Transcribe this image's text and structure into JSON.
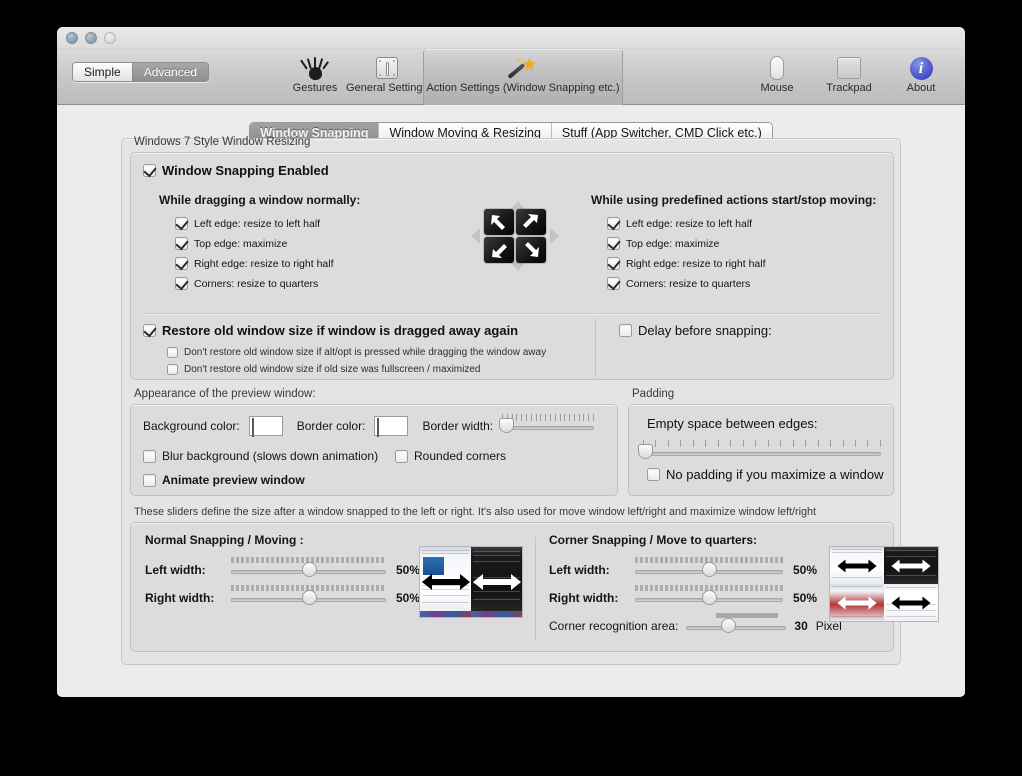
{
  "window": {
    "traffic_lights": [
      "close",
      "minimize",
      "zoom"
    ],
    "mode_segmented": {
      "options": [
        "Simple",
        "Advanced"
      ],
      "selected": "Advanced"
    },
    "toolbar_items": [
      {
        "label": "Gestures",
        "icon": "hand-icon",
        "selected": false
      },
      {
        "label": "General Settings",
        "icon": "mouse-general-icon",
        "selected": false
      },
      {
        "label": "Action Settings (Window Snapping etc.)",
        "icon": "magic-wand-icon",
        "selected": true
      }
    ],
    "toolbar_right_items": [
      {
        "label": "Mouse",
        "icon": "mouse-icon"
      },
      {
        "label": "Trackpad",
        "icon": "trackpad-icon"
      },
      {
        "label": "About",
        "icon": "info-icon"
      }
    ]
  },
  "tabs": [
    {
      "label": "Window Snapping",
      "active": true
    },
    {
      "label": "Window Moving & Resizing",
      "active": false
    },
    {
      "label": "Stuff (App Switcher, CMD Click etc.)",
      "active": false
    }
  ],
  "snapping": {
    "group_label": "Windows 7 Style Window Resizing",
    "enabled": {
      "label": "Window Snapping Enabled",
      "checked": true
    },
    "left_column": {
      "heading": "While dragging a window normally:",
      "items": [
        {
          "label": "Left edge: resize to left half",
          "checked": true
        },
        {
          "label": "Top edge: maximize",
          "checked": true
        },
        {
          "label": "Right edge: resize to right half",
          "checked": true
        },
        {
          "label": "Corners: resize to quarters",
          "checked": true
        }
      ]
    },
    "right_column": {
      "heading": "While using predefined actions start/stop moving:",
      "items": [
        {
          "label": "Left edge: resize to left half",
          "checked": true
        },
        {
          "label": "Top edge: maximize",
          "checked": true
        },
        {
          "label": "Right edge: resize to right half",
          "checked": true
        },
        {
          "label": "Corners: resize to quarters",
          "checked": true
        }
      ]
    },
    "restore": {
      "label": "Restore old window size if window is dragged away again",
      "checked": true,
      "sub_items": [
        {
          "label": "Don't restore old window size if alt/opt is pressed while dragging the window away",
          "checked": false
        },
        {
          "label": "Don't restore old window size if old size was fullscreen / maximized",
          "checked": false
        }
      ]
    },
    "delay": {
      "label": "Delay before snapping:",
      "checked": false
    }
  },
  "appearance": {
    "group_label": "Appearance of the preview window:",
    "background_color_label": "Background color:",
    "background_color": "#000000",
    "border_color_label": "Border color:",
    "border_color": "#ffffff",
    "border_width_label": "Border width:",
    "border_width_percent": 4,
    "checkboxes": [
      {
        "label": "Blur background (slows down animation)",
        "checked": false
      },
      {
        "label": "Rounded corners",
        "checked": false
      },
      {
        "label": "Animate preview window",
        "checked": false,
        "bold": true
      }
    ]
  },
  "padding": {
    "group_label": "Padding",
    "slider_label": "Empty space between edges:",
    "slider_percent": 1,
    "checkbox": {
      "label": "No padding if you maximize a window",
      "checked": false
    }
  },
  "sizes": {
    "group_label": "These sliders define the size after a window snapped to the left or right. It's also used for move window left/right and maximize window left/right",
    "normal": {
      "heading": "Normal Snapping / Moving :",
      "rows": [
        {
          "label": "Left width:",
          "value": "50%",
          "percent": 50
        },
        {
          "label": "Right width:",
          "value": "50%",
          "percent": 50
        }
      ]
    },
    "corner": {
      "heading": "Corner Snapping / Move to quarters:",
      "rows": [
        {
          "label": "Left width:",
          "value": "50%",
          "percent": 50
        },
        {
          "label": "Right width:",
          "value": "50%",
          "percent": 50
        }
      ],
      "recognition": {
        "label": "Corner recognition area:",
        "value": "30",
        "unit": "Pixel",
        "percent": 42
      }
    }
  }
}
